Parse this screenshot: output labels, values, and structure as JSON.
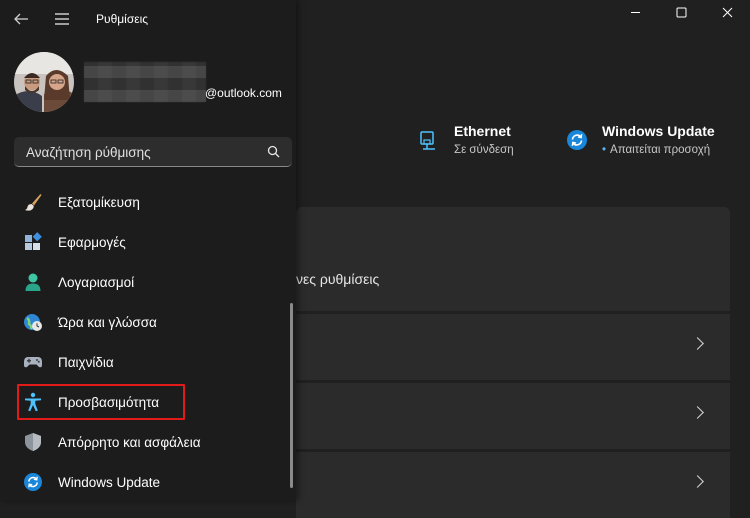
{
  "window": {
    "title": "Ρυθμίσεις"
  },
  "account": {
    "email_domain": "@outlook.com"
  },
  "search": {
    "placeholder": "Αναζήτηση ρύθμισης"
  },
  "nav_items": [
    {
      "label": "Εξατομίκευση",
      "icon": "paintbrush-icon"
    },
    {
      "label": "Εφαρμογές",
      "icon": "apps-icon"
    },
    {
      "label": "Λογαριασμοί",
      "icon": "person-icon"
    },
    {
      "label": "Ώρα και γλώσσα",
      "icon": "globe-clock-icon"
    },
    {
      "label": "Παιχνίδια",
      "icon": "gamepad-icon"
    },
    {
      "label": "Προσβασιμότητα",
      "icon": "accessibility-icon"
    },
    {
      "label": "Απόρρητο και ασφάλεια",
      "icon": "shield-icon"
    },
    {
      "label": "Windows Update",
      "icon": "sync-icon"
    }
  ],
  "status": {
    "ethernet": {
      "title": "Ethernet",
      "subtitle": "Σε σύνδεση"
    },
    "windows_update": {
      "title": "Windows Update",
      "subtitle": "Απαιτείται προσοχή"
    }
  },
  "main": {
    "card_text": "νες ρυθμίσεις"
  },
  "colors": {
    "accent": "#4cc2ff",
    "highlight_box": "#e11a1a",
    "pane_bg": "#1c1c1c",
    "main_bg": "#202020"
  }
}
